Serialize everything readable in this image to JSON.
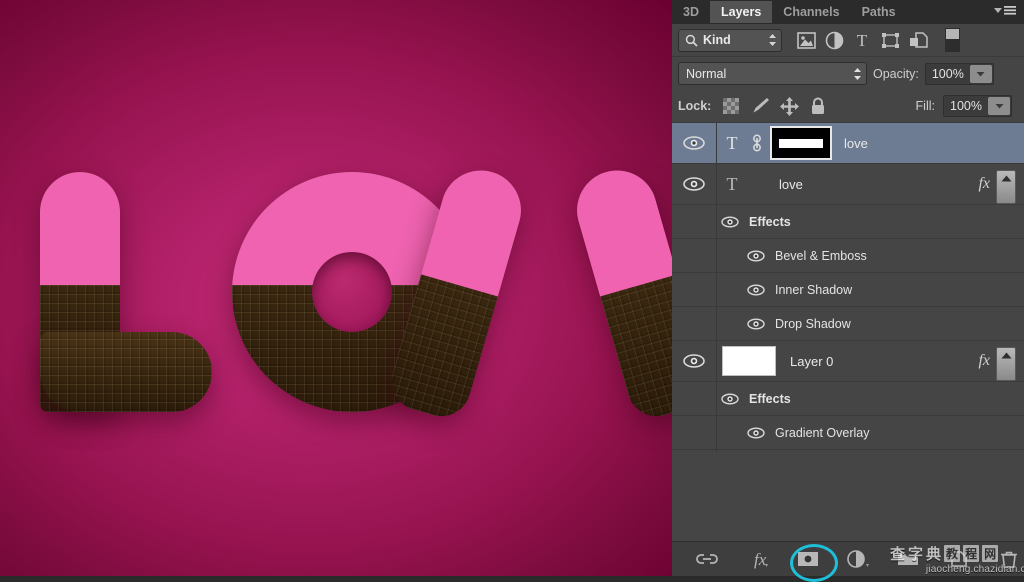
{
  "panel": {
    "tabs": [
      {
        "label": "3D",
        "active": false
      },
      {
        "label": "Layers",
        "active": true
      },
      {
        "label": "Channels",
        "active": false
      },
      {
        "label": "Paths",
        "active": false
      }
    ],
    "menu_icon": "panel-menu-icon",
    "filter": {
      "kind_label": "Kind",
      "search_icon": "search-icon",
      "stepper_icon": "updown-arrows-icon",
      "icons": [
        "pixel-layer-filter-icon",
        "adjustment-layer-filter-icon",
        "type-layer-filter-icon",
        "shape-layer-filter-icon",
        "smart-object-filter-icon",
        "filter-toggle-switch-icon"
      ]
    },
    "blend": {
      "mode": "Normal",
      "opacity_label": "Opacity:",
      "opacity_value": "100%"
    },
    "lock": {
      "label": "Lock:",
      "icons": [
        "lock-transparent-pixels-icon",
        "lock-image-pixels-icon",
        "lock-position-icon",
        "lock-all-icon"
      ],
      "fill_label": "Fill:",
      "fill_value": "100%"
    },
    "layers": [
      {
        "name": "love",
        "visible": true,
        "selected": true,
        "type_icon": "type-layer-T-icon",
        "link_icon": "link-mask-icon",
        "has_mask": true,
        "has_fx": false
      },
      {
        "name": "love",
        "visible": true,
        "selected": false,
        "type_icon": "type-layer-T-icon",
        "has_mask": false,
        "has_fx": true,
        "fx_label": "fx",
        "effects_label": "Effects",
        "effects": [
          "Bevel & Emboss",
          "Inner Shadow",
          "Drop Shadow"
        ]
      },
      {
        "name": "Layer 0",
        "visible": true,
        "selected": false,
        "thumb": "white-thumbnail",
        "has_fx": true,
        "fx_label": "fx",
        "effects_label": "Effects",
        "effects": [
          "Gradient Overlay"
        ]
      }
    ],
    "bottom_bar": {
      "icons": [
        "link-layers-icon",
        "add-layer-style-fx-icon",
        "add-layer-mask-icon",
        "new-adjustment-layer-icon",
        "new-group-icon",
        "new-layer-icon",
        "delete-layer-icon"
      ],
      "highlighted": "add-layer-mask-icon",
      "highlight_color": "#1ebfd8"
    }
  },
  "canvas": {
    "artwork_text": "LOV",
    "background_colors": {
      "center": "#c02a72",
      "edge": "#6b0030"
    },
    "letter_top_color": "#ef63b0",
    "letter_bottom_color": "#3b2810"
  },
  "watermark": {
    "chars": [
      "查",
      "字",
      "典"
    ],
    "boxed": [
      "教",
      "程",
      "网"
    ],
    "url": "jiaocheng.chazidian.com"
  }
}
